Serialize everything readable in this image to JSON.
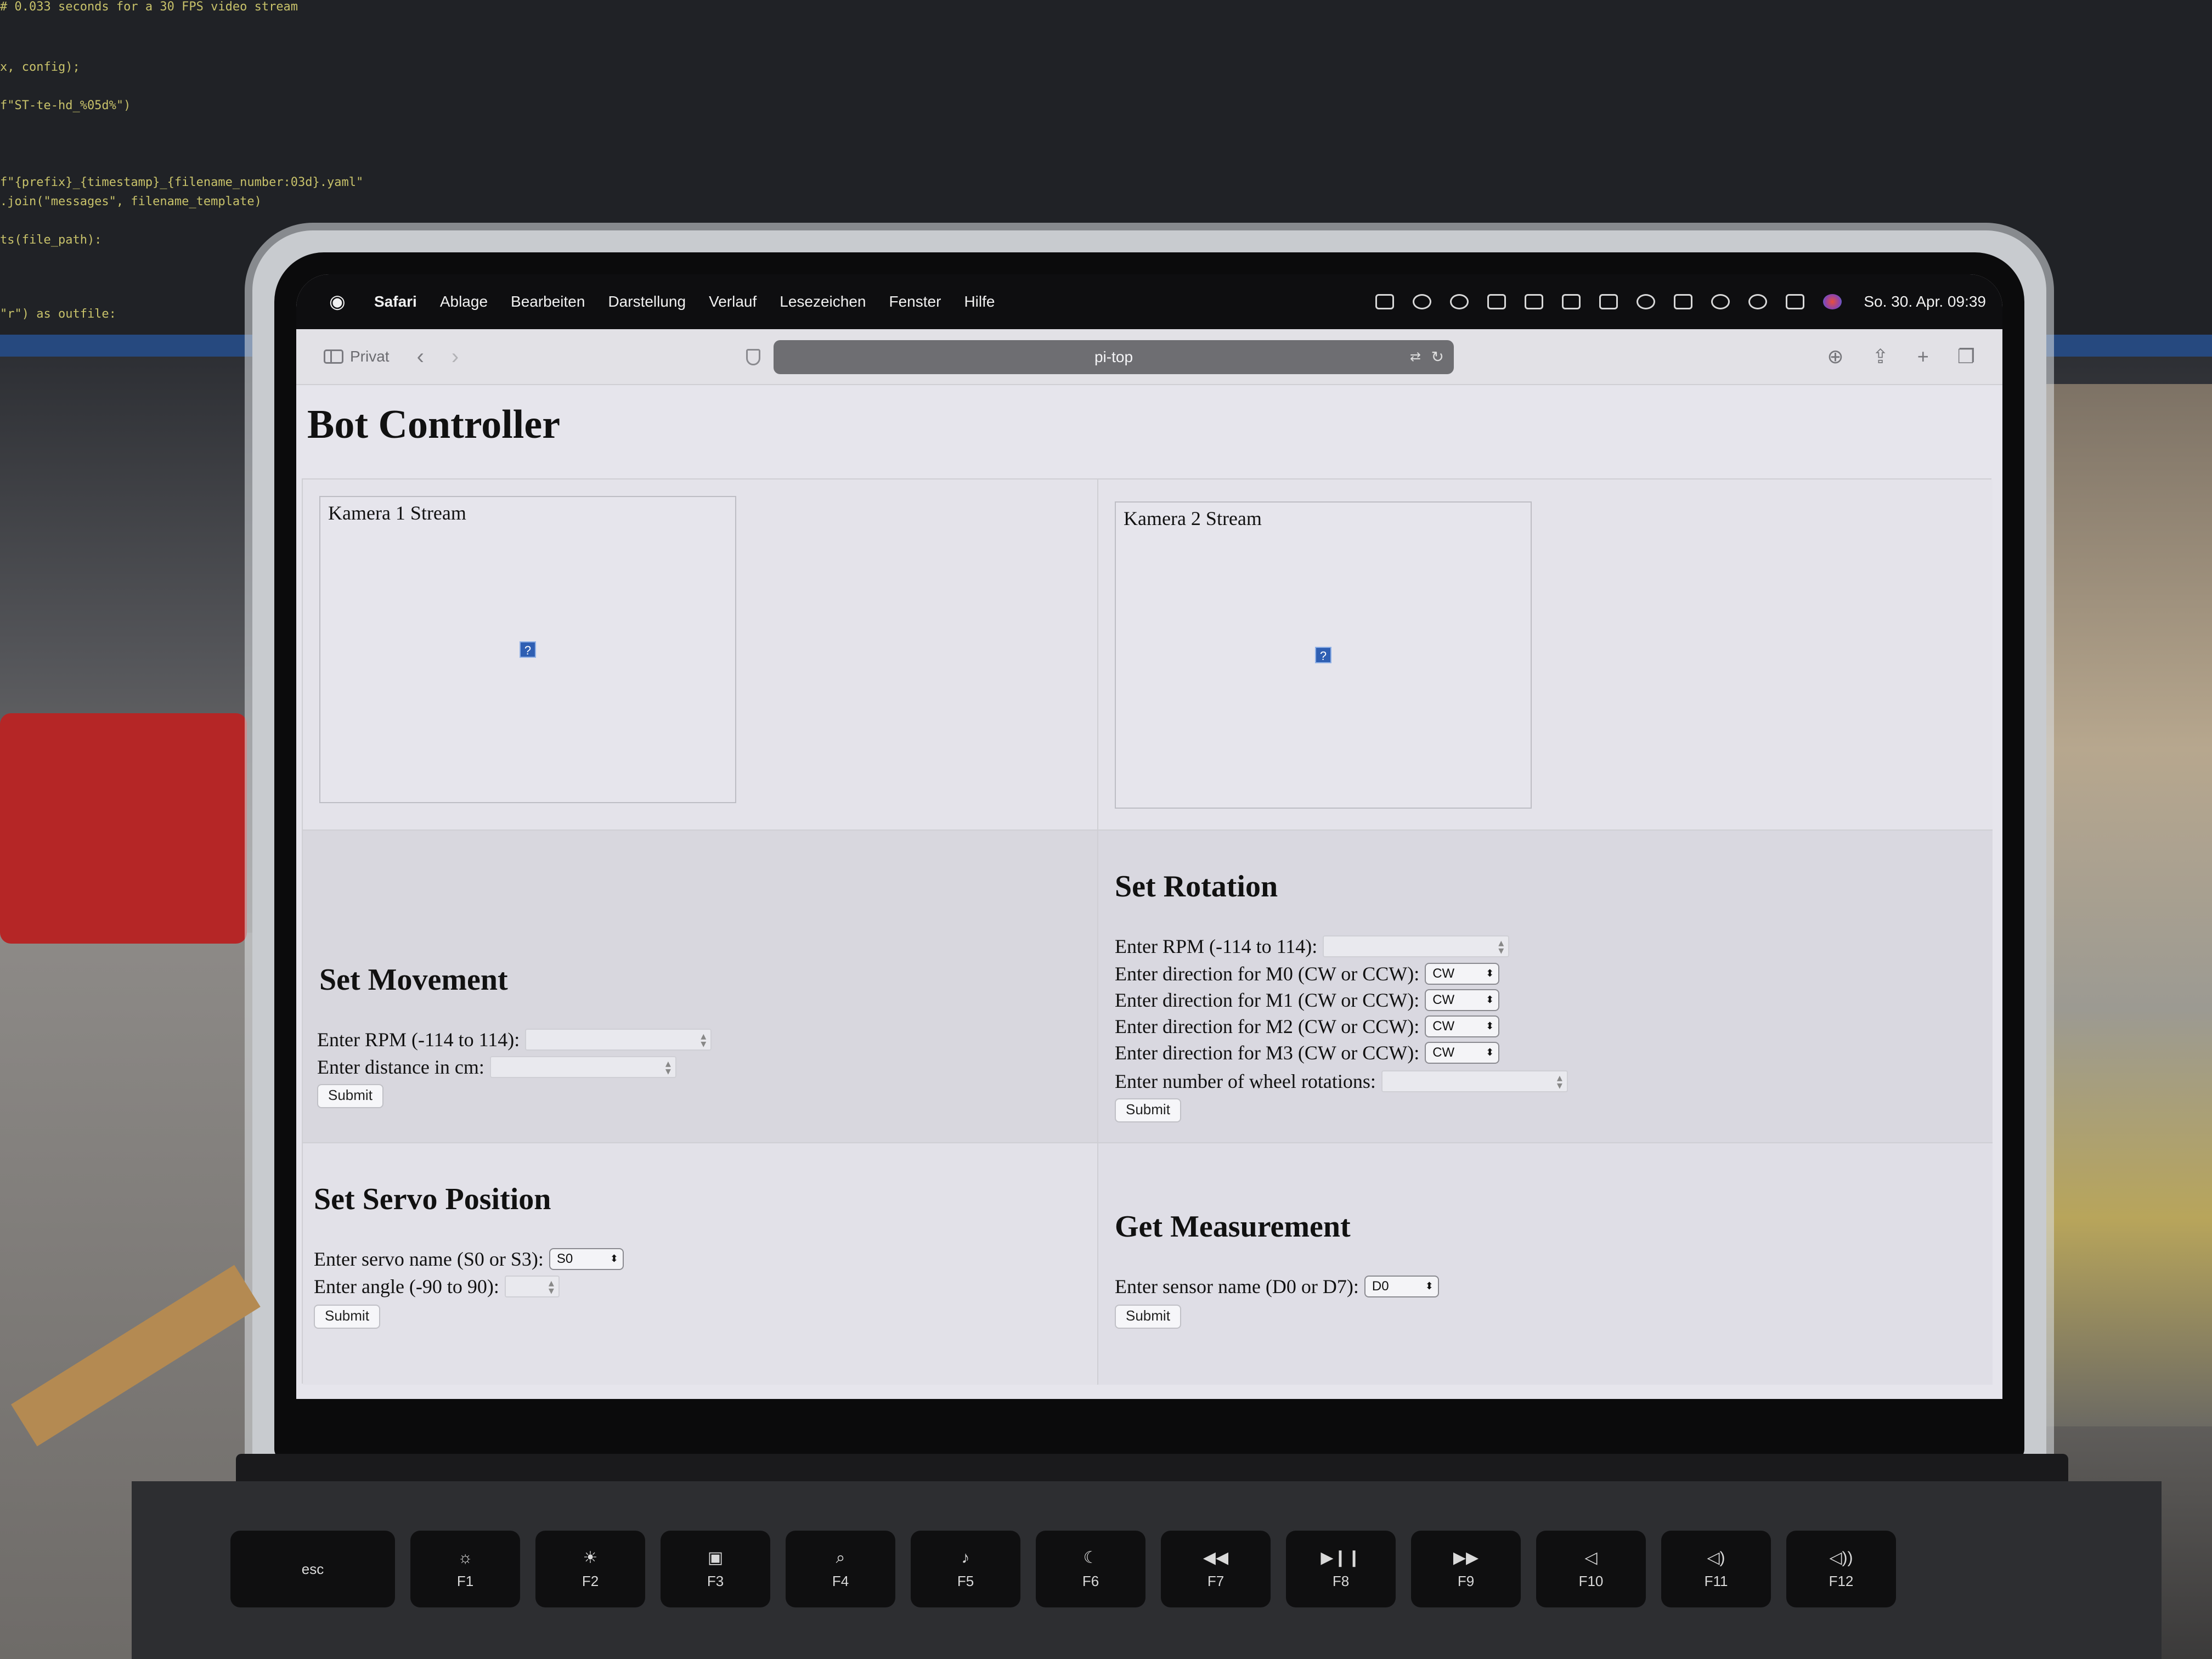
{
  "menubar": {
    "apple": "",
    "app": "Safari",
    "menus": [
      "Ablage",
      "Bearbeiten",
      "Darstellung",
      "Verlauf",
      "Lesezeichen",
      "Fenster",
      "Hilfe"
    ],
    "clock": "So. 30. Apr. 09:39"
  },
  "toolbar": {
    "private_label": "Privat",
    "back": "‹",
    "forward": "›",
    "url": "pi-top",
    "translate_glyph": "⇄",
    "reload_glyph": "↻",
    "download_glyph": "⊕",
    "share_glyph": "⇪",
    "new_tab_glyph": "+",
    "tabs_glyph": "❐"
  },
  "page": {
    "title": "Bot Controller",
    "camera1_alt": "Kamera 1 Stream",
    "camera2_alt": "Kamera 2 Stream",
    "broken_image_glyph": "?",
    "movement": {
      "title": "Set Movement",
      "rpm_label": "Enter RPM (-114 to 114):",
      "distance_label": "Enter distance in cm:",
      "submit": "Submit"
    },
    "rotation": {
      "title": "Set Rotation",
      "rpm_label": "Enter RPM (-114 to 114):",
      "m0_label": "Enter direction for M0 (CW or CCW):",
      "m1_label": "Enter direction for M1 (CW or CCW):",
      "m2_label": "Enter direction for M2 (CW or CCW):",
      "m3_label": "Enter direction for M3 (CW or CCW):",
      "m0_value": "CW",
      "m1_value": "CW",
      "m2_value": "CW",
      "m3_value": "CW",
      "rotations_label": "Enter number of wheel rotations:",
      "submit": "Submit"
    },
    "servo": {
      "title": "Set Servo Position",
      "name_label": "Enter servo name (S0 or S3):",
      "name_value": "S0",
      "angle_label": "Enter angle (-90 to 90):",
      "submit": "Submit"
    },
    "measurement": {
      "title": "Get Measurement",
      "sensor_label": "Enter sensor name (D0 or D7):",
      "sensor_value": "D0",
      "submit": "Submit"
    }
  },
  "keyboard": {
    "keys": [
      {
        "label": "esc",
        "icon": ""
      },
      {
        "label": "F1",
        "icon": "☼"
      },
      {
        "label": "F2",
        "icon": "☀"
      },
      {
        "label": "F3",
        "icon": "▣"
      },
      {
        "label": "F4",
        "icon": "⌕"
      },
      {
        "label": "F5",
        "icon": "♪"
      },
      {
        "label": "F6",
        "icon": "☾"
      },
      {
        "label": "F7",
        "icon": "◀◀"
      },
      {
        "label": "F8",
        "icon": "▶❙❙"
      },
      {
        "label": "F9",
        "icon": "▶▶"
      },
      {
        "label": "F10",
        "icon": "◁"
      },
      {
        "label": "F11",
        "icon": "◁)"
      },
      {
        "label": "F12",
        "icon": "◁))"
      }
    ]
  },
  "background_code": [
    "# 0.033 seconds for a 30 FPS video stream",
    "x, config);",
    "f\"ST-te-hd_%05d%\")",
    "f\"{prefix}_{timestamp}_{filename_number:03d}.yaml\"",
    ".join(\"messages\", filename_template)",
    "ts(file_path):",
    "\"r\") as outfile:"
  ]
}
